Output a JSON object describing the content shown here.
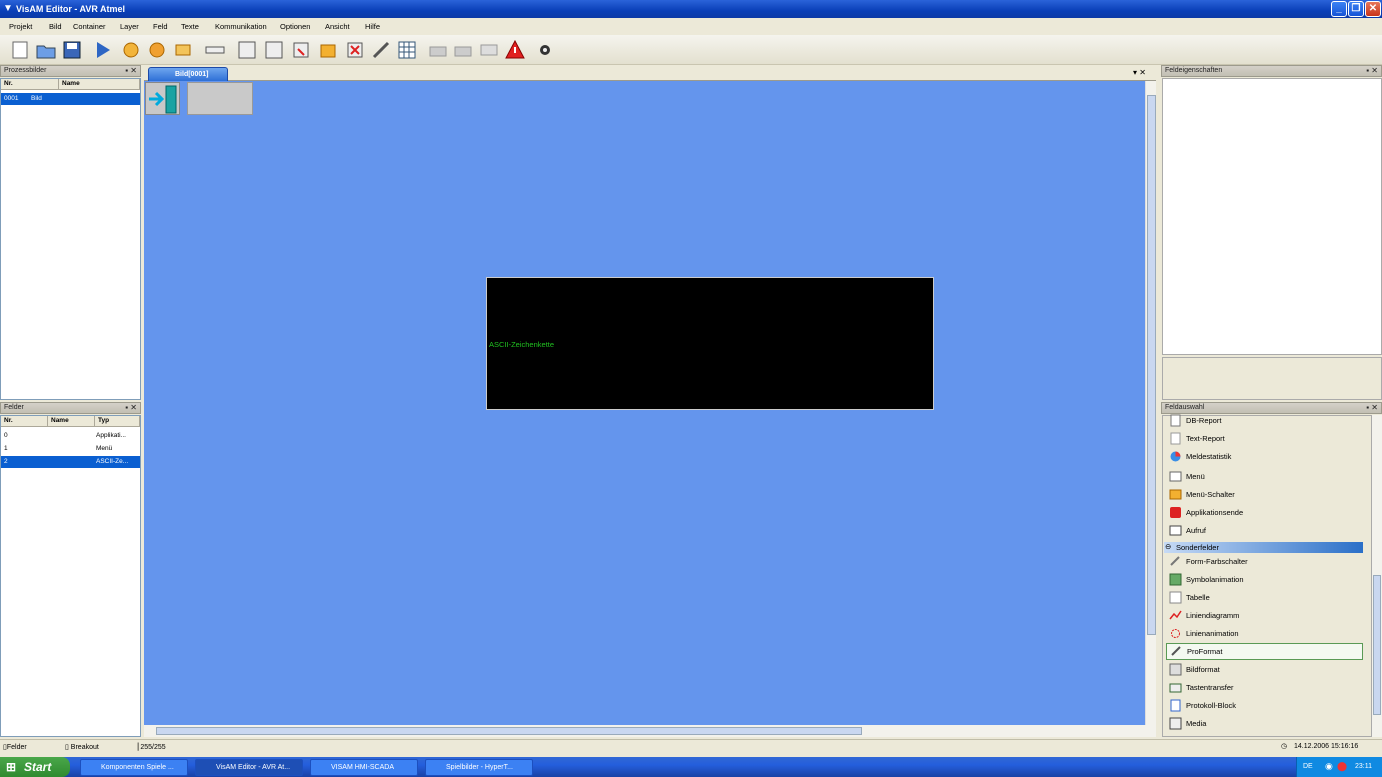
{
  "window": {
    "title": "VisAM Editor - AVR Atmel"
  },
  "menu": [
    "Projekt",
    "Bild",
    "Container",
    "Layer",
    "Feld",
    "Texte",
    "Kommunikation",
    "Optionen",
    "Ansicht",
    "Hilfe"
  ],
  "process_panel": {
    "title": "Prozessbilder",
    "headers": [
      "Nr.",
      "Name"
    ],
    "rows": [
      {
        "nr": "0001",
        "name": "Bild"
      }
    ]
  },
  "fields_panel": {
    "title": "Felder",
    "headers": [
      "Nr.",
      "Name",
      "Typ"
    ],
    "rows": [
      {
        "nr": "0",
        "name": "",
        "typ": "Applikati..."
      },
      {
        "nr": "1",
        "name": "",
        "typ": "Menü"
      },
      {
        "nr": "2",
        "name": "",
        "typ": "ASCII-Ze..."
      }
    ]
  },
  "document_tab": {
    "label": "Bild[0001]"
  },
  "canvas": {
    "display_text": "ASCII-Zeichenkette"
  },
  "properties_panel": {
    "title": "Feldeigenschaften"
  },
  "field_select_panel": {
    "title": "Feldauswahl",
    "items": [
      {
        "label": "DB-Report",
        "icon": "report-icon"
      },
      {
        "label": "Text-Report",
        "icon": "text-report-icon"
      },
      {
        "label": "Meldestatistik",
        "icon": "pie-chart-icon"
      },
      {
        "label": "Menü",
        "icon": "menu-icon"
      },
      {
        "label": "Menü-Schalter",
        "icon": "menu-switch-icon"
      },
      {
        "label": "Applikationsende",
        "icon": "power-icon"
      },
      {
        "label": "Aufruf",
        "icon": "call-icon"
      }
    ],
    "group": "Sonderfelder",
    "group_items": [
      {
        "label": "Form-Farbschalter",
        "icon": "shape-color-icon"
      },
      {
        "label": "Symbolanimation",
        "icon": "animation-icon"
      },
      {
        "label": "Tabelle",
        "icon": "table-icon"
      },
      {
        "label": "Liniendiagramm",
        "icon": "line-chart-icon"
      },
      {
        "label": "Linienanimation",
        "icon": "line-animation-icon"
      },
      {
        "label": "ProFormat",
        "icon": "proformat-icon"
      },
      {
        "label": "Bildformat",
        "icon": "image-format-icon"
      },
      {
        "label": "Tastentransfer",
        "icon": "key-transfer-icon"
      },
      {
        "label": "Protokoll-Block",
        "icon": "protocol-icon"
      },
      {
        "label": "Media",
        "icon": "media-icon"
      }
    ]
  },
  "statusbar": {
    "tab1": "Felder",
    "tab2": "Breakout",
    "coords": "255/255",
    "datetime": "14.12.2006 15:16:16"
  },
  "taskbar": {
    "start": "Start",
    "tasks": [
      "Komponenten Spiele ...",
      "VisAM Editor - AVR At...",
      "VISAM HMI-SCADA",
      "Spielbilder - HyperT..."
    ],
    "lang": "DE",
    "time": "23:11"
  },
  "colors": {
    "canvas": "#6495ed",
    "selection": "#0a5fd1",
    "display_text": "#20c020"
  }
}
